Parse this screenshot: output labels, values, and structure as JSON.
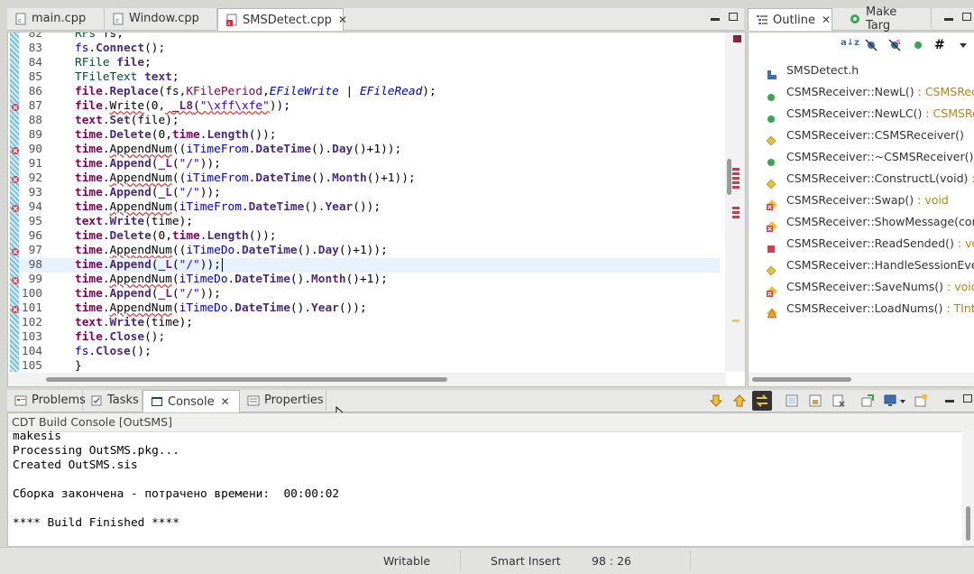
{
  "editor_tabs": [
    {
      "label": "main.cpp"
    },
    {
      "label": "Window.cpp"
    },
    {
      "label": "SMSDetect.cpp",
      "active": true
    }
  ],
  "outline_tabs": [
    {
      "label": "Outline",
      "active": true
    },
    {
      "label": "Make Targ"
    }
  ],
  "code_lines": [
    {
      "n": "82",
      "html": "<span class='ty'>RFs</span> fs;"
    },
    {
      "n": "83",
      "html": "<span class='vr'>fs</span>.<span class='fn'>Connect</span>();"
    },
    {
      "n": "84",
      "html": "<span class='ty'>RFile</span> <span class='fn'>file</span>;"
    },
    {
      "n": "85",
      "html": "<span class='ty'>TFileText</span> <span class='fn'>text</span>;"
    },
    {
      "n": "86",
      "html": "<span class='kw'>file</span>.<span class='fn'>Replace</span>(fs,<span class='kw' style='font-weight:normal;color:#7f0055'>KFilePeriod</span>,<span class='en'>EFileWrite</span> | <span class='en'>EFileRead</span>);"
    },
    {
      "n": "87",
      "html": "<span class='kw'>file</span>.<span class='wav'>Write</span>(0,<span class='wav'> <span class='mac'>_L8</span>(<span class='st'>\"\\xff\\xfe\"</span></span>));",
      "mark": true
    },
    {
      "n": "88",
      "html": "<span class='kw'>text</span>.<span class='fn'>Set</span>(file);"
    },
    {
      "n": "89",
      "html": "<span class='kw'>time</span>.<span class='fn'>Delete</span>(0,<span class='kw'>time</span>.<span class='fn'>Length</span>());"
    },
    {
      "n": "90",
      "html": "<span class='kw'>time</span>.<span class='wav'>AppendNum</span>((<span class='vr'>iTimeFrom</span>.<span class='fn'>DateTime</span>().<span class='fn'>Day</span>()+1));",
      "mark": true
    },
    {
      "n": "91",
      "html": "<span class='kw'>time</span>.<span class='fn'>Append</span>(<span class='mac'>_L</span>(<span class='st'>\"/\"</span>));"
    },
    {
      "n": "92",
      "html": "<span class='kw'>time</span>.<span class='wav'>AppendNum</span>((<span class='vr'>iTimeFrom</span>.<span class='fn'>DateTime</span>().<span class='fn'>Month</span>()+1));",
      "mark": true
    },
    {
      "n": "93",
      "html": "<span class='kw'>time</span>.<span class='fn'>Append</span>(<span class='mac'>_L</span>(<span class='st'>\"/\"</span>));"
    },
    {
      "n": "94",
      "html": "<span class='kw'>time</span>.<span class='wav'>AppendNum</span>(<span class='vr'>iTimeFrom</span>.<span class='fn'>DateTime</span>().<span class='fn'>Year</span>());",
      "mark": true
    },
    {
      "n": "95",
      "html": "<span class='kw'>text</span>.<span class='fn'>Write</span>(time);"
    },
    {
      "n": "96",
      "html": "<span class='kw'>time</span>.<span class='fn'>Delete</span>(0,<span class='kw'>time</span>.<span class='fn'>Length</span>());"
    },
    {
      "n": "97",
      "html": "<span class='kw'>time</span>.<span class='wav'>AppendNum</span>((<span class='vr'>iTimeDo</span>.<span class='fn'>DateTime</span>().<span class='fn'>Day</span>()+1));",
      "mark": true
    },
    {
      "n": "98",
      "html": "<span class='kw'>time</span>.<span class='fn'>Append</span>(<span class='mac'>_L</span>(<span class='st'>\"/\"</span>));",
      "cur": true
    },
    {
      "n": "99",
      "html": "<span class='kw'>time</span>.<span class='wav'>AppendNum</span>(<span class='vr'>iTimeDo</span>.<span class='fn'>DateTime</span>().<span class='fn'>Month</span>()+1);",
      "mark": true
    },
    {
      "n": "100",
      "html": "<span class='kw'>time</span>.<span class='fn'>Append</span>(<span class='mac'>_L</span>(<span class='st'>\"/\"</span>));"
    },
    {
      "n": "101",
      "html": "<span class='kw'>time</span>.<span class='wav'>AppendNum</span>(<span class='vr'>iTimeDo</span>.<span class='fn'>DateTime</span>().<span class='fn'>Year</span>());",
      "mark": true
    },
    {
      "n": "102",
      "html": "<span class='kw'>text</span>.<span class='fn'>Write</span>(time);"
    },
    {
      "n": "103",
      "html": "<span class='kw'>file</span>.<span class='fn'>Close</span>();"
    },
    {
      "n": "104",
      "html": "<span class='vr'>fs</span>.<span class='fn'>Close</span>();"
    },
    {
      "n": "105",
      "html": "}"
    }
  ],
  "outline_items": [
    {
      "label": "SMSDetect.h",
      "suffix": "",
      "icon": "header-file-icon",
      "color": "#3a6fb0"
    },
    {
      "label": "CSMSReceiver::NewL()",
      "suffix": " : CSMSReceiv",
      "icon": "public-method-icon",
      "color": "#3aa655"
    },
    {
      "label": "CSMSReceiver::NewLC()",
      "suffix": " : CSMSRece",
      "icon": "public-method-icon",
      "color": "#3aa655"
    },
    {
      "label": "CSMSReceiver::CSMSReceiver()",
      "suffix": "",
      "icon": "constructor-icon",
      "color": "#e8c040"
    },
    {
      "label": "CSMSReceiver::~CSMSReceiver()",
      "suffix": "",
      "icon": "public-method-icon",
      "color": "#3aa655"
    },
    {
      "label": "CSMSReceiver::ConstructL(void)",
      "suffix": " : vo",
      "icon": "constructor-icon",
      "color": "#e8c040"
    },
    {
      "label": "CSMSReceiver::Swap()",
      "suffix": " : void",
      "icon": "error-method-icon",
      "color": "#d04050"
    },
    {
      "label": "CSMSReceiver::ShowMessage(cons",
      "suffix": "",
      "icon": "error-method-icon",
      "color": "#d04050"
    },
    {
      "label": "CSMSReceiver::ReadSended()",
      "suffix": " : void",
      "icon": "private-method-icon",
      "color": "#d04050"
    },
    {
      "label": "CSMSReceiver::HandleSessionEvent",
      "suffix": "",
      "icon": "constructor-icon",
      "color": "#e8c040"
    },
    {
      "label": "CSMSReceiver::SaveNums()",
      "suffix": " : void",
      "icon": "error-method-icon",
      "color": "#d04050"
    },
    {
      "label": "CSMSReceiver::LoadNums()",
      "suffix": " : TInt",
      "icon": "warning-method-icon",
      "color": "#e8a030"
    }
  ],
  "bottom_tabs": [
    {
      "label": "Problems"
    },
    {
      "label": "Tasks"
    },
    {
      "label": "Console",
      "active": true
    },
    {
      "label": "Properties"
    }
  ],
  "console": {
    "title": "CDT Build Console [OutSMS]",
    "lines": [
      "makesis",
      "Processing OutSMS.pkg...",
      "Created OutSMS.sis",
      "",
      "Сборка закончена - потрачено времени:  00:00:02",
      "",
      "**** Build Finished ****"
    ]
  },
  "status": {
    "writable": "Writable",
    "insert_mode": "Smart Insert",
    "position": "98 : 26"
  }
}
